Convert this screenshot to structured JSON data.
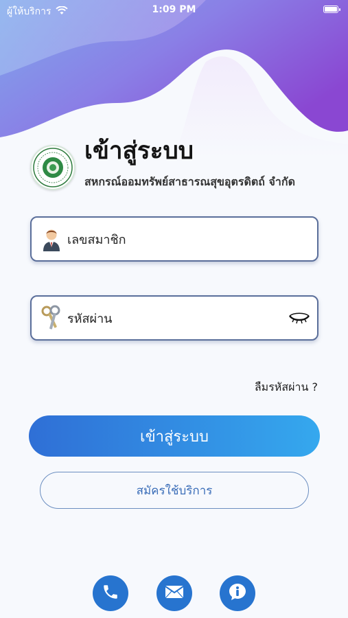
{
  "status_bar": {
    "carrier": "ผู้ให้บริการ",
    "time": "1:09 PM",
    "wifi_icon": "wifi-icon",
    "battery_icon": "battery-icon"
  },
  "header": {
    "title": "เข้าสู่ระบบ",
    "organization": "สหกรณ์ออมทรัพย์สาธารณสุขอุตรดิตถ์ จำกัด",
    "logo_icon": "organization-seal-logo"
  },
  "form": {
    "member_field": {
      "placeholder": "เลขสมาชิก",
      "icon": "user-avatar-icon"
    },
    "password_field": {
      "placeholder": "รหัสผ่าน",
      "icon": "keys-icon",
      "toggle_icon": "eye-closed-icon"
    },
    "forgot_password": "ลืมรหัสผ่าน ?"
  },
  "actions": {
    "login_label": "เข้าสู่ระบบ",
    "register_label": "สมัครใช้บริการ"
  },
  "footer": {
    "buttons": [
      "phone-icon",
      "mail-icon",
      "info-icon"
    ]
  },
  "colors": {
    "primary": "#2774cf",
    "gradient_start": "#2f6fd6",
    "gradient_end": "#35a8ee",
    "hero_purple": "#7a4fd6",
    "hero_blue": "#6e8fe8"
  }
}
